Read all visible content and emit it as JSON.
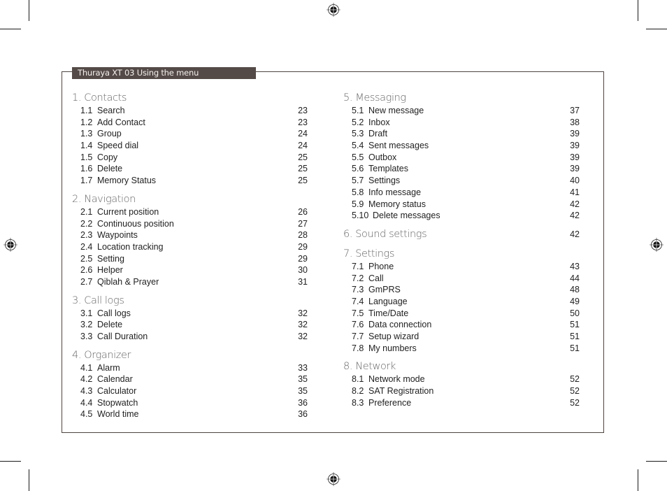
{
  "header": {
    "title": "Thuraya XT  03 Using the menu"
  },
  "left_column": [
    {
      "title": "1. Contacts",
      "items": [
        {
          "num": "1.1",
          "label": "Search",
          "page": "23"
        },
        {
          "num": "1.2",
          "label": "Add Contact",
          "page": "23"
        },
        {
          "num": "1.3",
          "label": "Group",
          "page": "24"
        },
        {
          "num": "1.4",
          "label": "Speed dial",
          "page": "24"
        },
        {
          "num": "1.5",
          "label": "Copy",
          "page": "25"
        },
        {
          "num": "1.6",
          "label": "Delete",
          "page": "25"
        },
        {
          "num": "1.7",
          "label": "Memory Status",
          "page": "25"
        }
      ]
    },
    {
      "title": "2. Navigation",
      "items": [
        {
          "num": "2.1",
          "label": "Current position",
          "page": "26"
        },
        {
          "num": "2.2",
          "label": "Continuous position",
          "page": "27"
        },
        {
          "num": "2.3",
          "label": "Waypoints",
          "page": "28"
        },
        {
          "num": "2.4",
          "label": "Location tracking",
          "page": "29"
        },
        {
          "num": "2.5",
          "label": "Setting",
          "page": "29"
        },
        {
          "num": "2.6",
          "label": "Helper",
          "page": "30"
        },
        {
          "num": "2.7",
          "label": "Qiblah & Prayer",
          "page": "31"
        }
      ]
    },
    {
      "title": "3. Call logs",
      "items": [
        {
          "num": "3.1",
          "label": "Call logs",
          "page": "32"
        },
        {
          "num": "3.2",
          "label": "Delete",
          "page": "32"
        },
        {
          "num": "3.3",
          "label": "Call Duration",
          "page": "32"
        }
      ]
    },
    {
      "title": "4. Organizer",
      "items": [
        {
          "num": "4.1",
          "label": "Alarm",
          "page": "33"
        },
        {
          "num": "4.2",
          "label": "Calendar",
          "page": "35"
        },
        {
          "num": "4.3",
          "label": "Calculator",
          "page": "35"
        },
        {
          "num": "4.4",
          "label": "Stopwatch",
          "page": "36"
        },
        {
          "num": "4.5",
          "label": "World time",
          "page": "36"
        }
      ]
    }
  ],
  "right_column": [
    {
      "title": "5. Messaging",
      "items": [
        {
          "num": "5.1",
          "label": "New message",
          "page": "37"
        },
        {
          "num": "5.2",
          "label": "Inbox",
          "page": "38"
        },
        {
          "num": "5.3",
          "label": "Draft",
          "page": "39"
        },
        {
          "num": "5.4",
          "label": "Sent messages",
          "page": "39"
        },
        {
          "num": "5.5",
          "label": "Outbox",
          "page": "39"
        },
        {
          "num": "5.6",
          "label": "Templates",
          "page": "39"
        },
        {
          "num": "5.7",
          "label": "Settings",
          "page": "40"
        },
        {
          "num": "5.8",
          "label": "Info message",
          "page": "41"
        },
        {
          "num": "5.9",
          "label": "Memory status",
          "page": "42"
        },
        {
          "num": "5.10",
          "label": "Delete messages",
          "page": "42"
        }
      ]
    },
    {
      "title": "6. Sound settings",
      "page": "42",
      "items": []
    },
    {
      "title": "7. Settings",
      "items": [
        {
          "num": "7.1",
          "label": "Phone",
          "page": "43"
        },
        {
          "num": "7.2",
          "label": "Call",
          "page": "44"
        },
        {
          "num": "7.3",
          "label": "GmPRS",
          "page": "48"
        },
        {
          "num": "7.4",
          "label": "Language",
          "page": "49"
        },
        {
          "num": "7.5",
          "label": "Time/Date",
          "page": "50"
        },
        {
          "num": "7.6",
          "label": "Data connection",
          "page": "51"
        },
        {
          "num": "7.7",
          "label": "Setup wizard",
          "page": "51"
        },
        {
          "num": "7.8",
          "label": "My numbers",
          "page": "51"
        }
      ]
    },
    {
      "title": "8. Network",
      "items": [
        {
          "num": "8.1",
          "label": "Network mode",
          "page": "52"
        },
        {
          "num": "8.2",
          "label": "SAT Registration",
          "page": "52"
        },
        {
          "num": "8.3",
          "label": "Preference",
          "page": "52"
        }
      ]
    }
  ],
  "marks": {
    "crop_marks": [
      "top-left",
      "top-right",
      "bottom-left",
      "bottom-right"
    ],
    "registration_marks": [
      "top-center",
      "left-middle",
      "right-middle",
      "bottom-center"
    ]
  },
  "colors": {
    "frame": "#4e4441",
    "header_bg": "#544a47",
    "header_text": "#f3f0ee",
    "section_title": "#666666"
  }
}
